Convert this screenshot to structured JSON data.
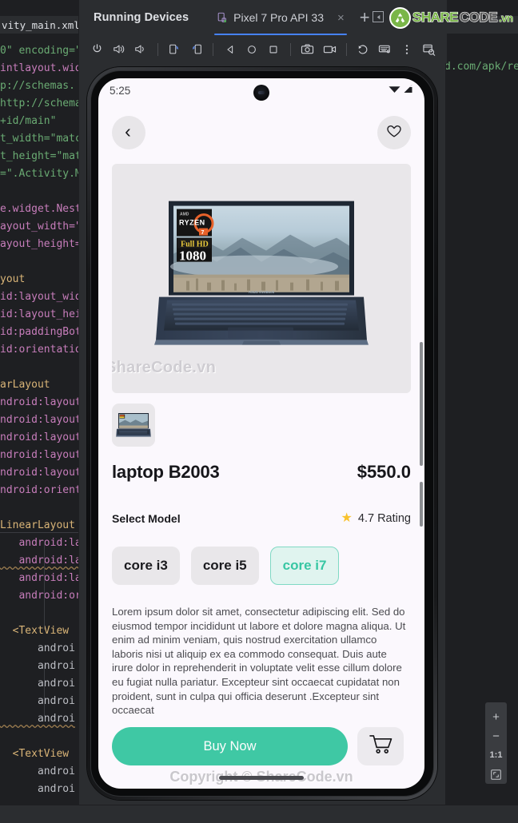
{
  "ide": {
    "editor_tab": {
      "label": "vity_main.xml",
      "close_glyph": "×"
    },
    "code_left": [
      "0\" encoding=\"",
      "intlayout.wid",
      "p://schemas.",
      "http://schema",
      "+id/main\"",
      "t_width=\"matc",
      "t_height=\"mat",
      "=\".Activity.M",
      "",
      "e.widget.Nest",
      "ayout_width=\"",
      "ayout_height=",
      "",
      "yout",
      "id:layout_wid",
      "id:layout_hei",
      "id:paddingBot",
      "id:orientatio",
      "",
      "arLayout",
      "ndroid:layout",
      "ndroid:layout",
      "ndroid:layout",
      "ndroid:layout",
      "ndroid:layout",
      "ndroid:orient",
      "",
      "LinearLayout",
      "   android:la",
      "   android:la",
      "   android:la",
      "   android:or",
      "",
      "  <TextView",
      "      androi",
      "      androi",
      "      androi",
      "      androi",
      "      androi",
      "",
      "  <TextView",
      "      androi",
      "      androi"
    ],
    "code_right": [
      "d.com/apk/re"
    ]
  },
  "running_devices": {
    "title": "Running Devices",
    "tab": {
      "label": "Pixel 7 Pro API 33",
      "close_glyph": "×"
    },
    "add_tab_glyph": "+",
    "toolbar": [
      {
        "name": "power-icon",
        "glyph": "⏻"
      },
      {
        "name": "volume-up-icon",
        "glyph": "🔊"
      },
      {
        "name": "volume-down-icon",
        "glyph": "🔉"
      },
      {
        "name": "rotate-left-icon",
        "glyph": "↺"
      },
      {
        "name": "rotate-right-icon",
        "glyph": "↻"
      },
      {
        "name": "back-nav-icon",
        "glyph": "◁"
      },
      {
        "name": "home-nav-icon",
        "glyph": "○"
      },
      {
        "name": "overview-nav-icon",
        "glyph": "□"
      },
      {
        "name": "screenshot-icon",
        "glyph": "📷"
      },
      {
        "name": "screen-record-icon",
        "glyph": "🎥"
      },
      {
        "name": "back-to-time-icon",
        "glyph": "↺"
      },
      {
        "name": "keyboard-shortcuts-icon",
        "glyph": "⌨"
      },
      {
        "name": "more-options-icon",
        "glyph": "⋮"
      },
      {
        "name": "device-inspect-icon",
        "glyph": "❐"
      }
    ],
    "zoom_panel": {
      "zoom_in": "+",
      "zoom_out": "−",
      "actual_size": "1:1",
      "fit_to_window": "❐"
    }
  },
  "branding": {
    "mark": "recycle-logo",
    "share": "SHARE",
    "code": "CODE",
    "vn": ".vn"
  },
  "phone": {
    "status_bar": {
      "time": "5:25",
      "wifi_icon": "wifi-icon",
      "signal_icon": "cellular-signal-icon"
    },
    "app": {
      "back_button_glyph": "‹",
      "favorite_icon": "heart-outline-icon",
      "hero_watermark": "ShareCode.vn",
      "product_title": "laptop B2003",
      "product_price": "$550.0",
      "select_model_label": "Select Model",
      "rating_value": "4.7 Rating",
      "star_glyph": "★",
      "models": [
        {
          "label": "core i3",
          "selected": false
        },
        {
          "label": "core i5",
          "selected": false
        },
        {
          "label": "core i7",
          "selected": true
        }
      ],
      "description": "Lorem ipsum dolor sit amet, consectetur adipiscing elit. Sed do eiusmod tempor incididunt ut labore et dolore magna aliqua. Ut enim ad minim veniam, quis nostrud exercitation ullamco laboris nisi ut aliquip ex ea commodo consequat. Duis aute irure dolor in reprehenderit in voluptate velit esse  cillum dolore eu fugiat nulla pariatur. Excepteur sint occaecat  cupidatat non proident, sunt in culpa qui officia deserunt .Excepteur sint occaecat",
      "buy_button": "Buy Now",
      "cart_icon": "shopping-cart-icon",
      "footer_watermark": "Copyright © ShareCode.vn",
      "laptop_badges": {
        "cpu": "RYZEN",
        "cpu_tier": "7",
        "vendor": "AMD",
        "fullhd": "Full HD",
        "res": "1080",
        "brand": "ASUS VivoBook"
      }
    }
  },
  "colors": {
    "accent_green": "#3fc8a4",
    "chip_selected_bg": "#e0f4ef",
    "chip_selected_text": "#37c6a3",
    "ide_bg": "#1e1f22",
    "panel_bg": "#2b2d30",
    "tab_underline": "#4682fa",
    "star_yellow": "#f9c22e"
  }
}
